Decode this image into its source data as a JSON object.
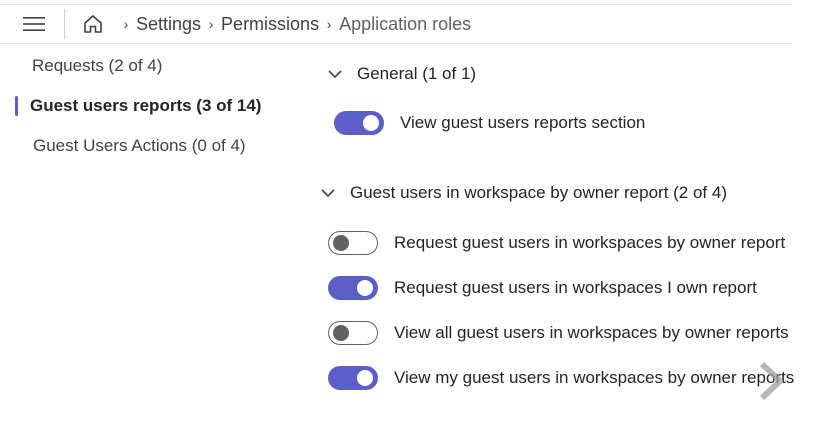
{
  "header": {
    "menu_icon": "hamburger-icon",
    "home_icon": "home-icon",
    "breadcrumbs": [
      "Settings",
      "Permissions",
      "Application roles"
    ]
  },
  "nav": {
    "items": [
      {
        "label": "Requests (2 of 4)",
        "selected": false
      },
      {
        "label": "Guest users reports (3 of 14)",
        "selected": true
      },
      {
        "label": "Guest Users Actions (0 of 4)",
        "selected": false
      }
    ]
  },
  "sections": [
    {
      "title": "General (1 of 1)",
      "expanded": true,
      "permissions": [
        {
          "label": "View guest users reports section",
          "enabled": true
        }
      ]
    },
    {
      "title": "Guest users in workspace by owner report (2 of 4)",
      "expanded": true,
      "permissions": [
        {
          "label": "Request guest users in workspaces by owner report",
          "enabled": false
        },
        {
          "label": "Request guest users in workspaces I own report",
          "enabled": true
        },
        {
          "label": "View all guest users in workspaces by owner reports",
          "enabled": false
        },
        {
          "label": "View my guest users in workspaces by owner reports",
          "enabled": true
        }
      ]
    }
  ],
  "colors": {
    "accent": "#5b5fc7",
    "toggle_off": "#616161"
  },
  "overlay": {
    "icon": "chevron-right-icon"
  }
}
